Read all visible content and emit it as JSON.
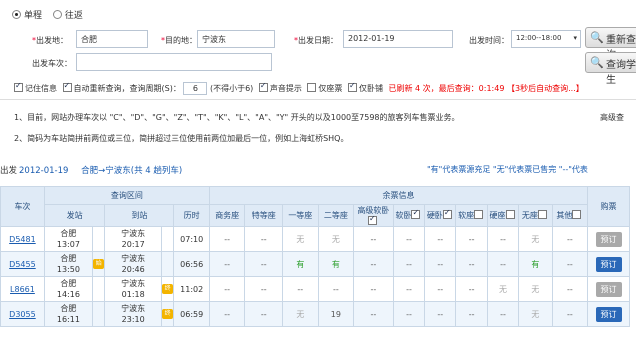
{
  "trip_type": {
    "one_way": "单程",
    "round_trip": "往返"
  },
  "from": {
    "label": "出发地：",
    "value": "合肥"
  },
  "to": {
    "label": "目的地：",
    "value": "宁波东"
  },
  "date": {
    "label": "出发日期：",
    "value": "2012-01-19"
  },
  "time": {
    "label": "出发时间：",
    "value": "12:00--18:00"
  },
  "train_no": {
    "label": "出发车次：",
    "value": ""
  },
  "buttons": {
    "requery": "重新查询",
    "student": "查询学生"
  },
  "options": {
    "remember": "记住信息",
    "auto_label": "自动重新查询，查询周期(S)：",
    "period": "6",
    "period_hint": "(不得小于6)",
    "sound": "声音提示",
    "only_ticket": "仅座票",
    "only_sleeper": "仅卧铺",
    "refresh_status": "已刷新 4 次，最后查询：0:1:49",
    "refresh_hint": "【3秒后自动查询...】"
  },
  "notices": [
    "1、目前，网站办理车次以 \"C\"、\"D\"、\"G\"、\"Z\"、\"T\"、\"K\"、\"L\"、\"A\"、\"Y\" 开头的以及1000至7598的旅客列车售票业务。",
    "2、简码为车站简拼前两位或三位，简拼超过三位使用前两位加最后一位，例如上海虹桥SHQ。"
  ],
  "advanced": "高级查",
  "summary": {
    "prefix": "出发",
    "date": "2012-01-19",
    "route": "合肥→宁波东",
    "count": "(共 4 趟列车)",
    "legend": "\"有\"代表票源充足  \"无\"代表票已售完  \"--\"代表"
  },
  "table": {
    "train_col": "车次",
    "range_col": "查询区间",
    "from_col": "发站",
    "to_col": "到站",
    "duration_col": "历时",
    "seat_group": "余票信息",
    "book_col": "购票",
    "seat_cols": [
      "商务座",
      "特等座",
      "一等座",
      "二等座",
      "高级软卧",
      "软卧",
      "硬卧",
      "软座",
      "硬座",
      "无座",
      "其他"
    ],
    "rows": [
      {
        "train": "D5481",
        "from": "合肥",
        "dep": "13:07",
        "to": "宁波东",
        "arr": "20:17",
        "duration": "07:10",
        "seats": [
          "--",
          "--",
          "无",
          "无",
          "--",
          "--",
          "--",
          "--",
          "--",
          "无",
          "--"
        ],
        "book": "预订",
        "bookable": false,
        "badge_from": "",
        "badge_to": ""
      },
      {
        "train": "D5455",
        "from": "合肥",
        "dep": "13:50",
        "to": "宁波东",
        "arr": "20:46",
        "duration": "06:56",
        "seats": [
          "--",
          "--",
          "有",
          "有",
          "--",
          "--",
          "--",
          "--",
          "--",
          "有",
          "--"
        ],
        "book": "预订",
        "bookable": true,
        "badge_from": "始",
        "badge_to": ""
      },
      {
        "train": "L8661",
        "from": "合肥",
        "dep": "14:16",
        "to": "宁波东",
        "arr": "01:18",
        "duration": "11:02",
        "seats": [
          "--",
          "--",
          "--",
          "--",
          "--",
          "--",
          "--",
          "--",
          "无",
          "无",
          "--"
        ],
        "book": "预订",
        "bookable": false,
        "badge_from": "",
        "badge_to": "终"
      },
      {
        "train": "D3055",
        "from": "合肥",
        "dep": "16:11",
        "to": "宁波东",
        "arr": "23:10",
        "duration": "06:59",
        "seats": [
          "--",
          "--",
          "无",
          "19",
          "--",
          "--",
          "--",
          "--",
          "--",
          "无",
          "--"
        ],
        "book": "预订",
        "bookable": true,
        "badge_from": "",
        "badge_to": "终"
      }
    ]
  }
}
